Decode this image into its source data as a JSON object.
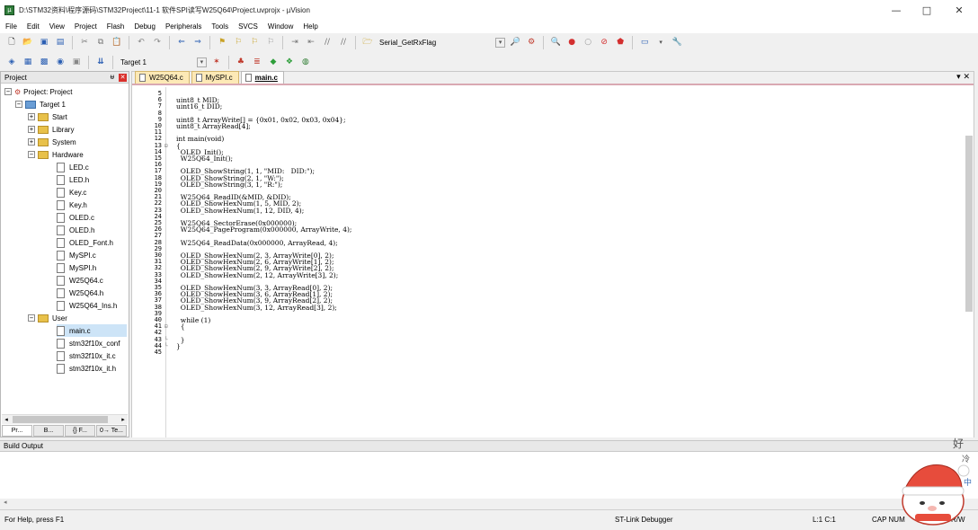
{
  "window": {
    "title": "D:\\STM32资料\\程序源码\\STM32Project\\11-1 软件SPI读写W25Q64\\Project.uvprojx - µVision",
    "minimize": "—",
    "maximize": "□",
    "close": "✕"
  },
  "menu": [
    "File",
    "Edit",
    "View",
    "Project",
    "Flash",
    "Debug",
    "Peripherals",
    "Tools",
    "SVCS",
    "Window",
    "Help"
  ],
  "toolbar": {
    "find_combo": "Serial_GetRxFlag",
    "target_combo": "Target 1"
  },
  "project_panel": {
    "title": "Project",
    "pin": "ᵾ",
    "close": "✕",
    "tree": {
      "root": "Project: Project",
      "target": "Target 1",
      "groups": [
        "Start",
        "Library",
        "System"
      ],
      "hardware": {
        "label": "Hardware",
        "files": [
          "LED.c",
          "LED.h",
          "Key.c",
          "Key.h",
          "OLED.c",
          "OLED.h",
          "OLED_Font.h",
          "MySPI.c",
          "MySPI.h",
          "W25Q64.c",
          "W25Q64.h",
          "W25Q64_Ins.h"
        ]
      },
      "user": {
        "label": "User",
        "files": [
          "main.c",
          "stm32f10x_conf",
          "stm32f10x_it.c",
          "stm32f10x_it.h"
        ]
      }
    },
    "tabs": [
      "Pr...",
      "B...",
      "{} F...",
      "0→ Te..."
    ]
  },
  "editor": {
    "tabs": [
      "W25Q64.c",
      "MySPI.c",
      "main.c"
    ],
    "active_tab": "main.c",
    "close": "▾ ✕",
    "lines": [
      {
        "n": "5",
        "t": ""
      },
      {
        "n": "6",
        "t": "uint8_t MID;"
      },
      {
        "n": "7",
        "t": "uint16_t DID;"
      },
      {
        "n": "8",
        "t": ""
      },
      {
        "n": "9",
        "t": "uint8_t ArrayWrite[] = {0x01, 0x02, 0x03, 0x04};"
      },
      {
        "n": "10",
        "t": "uint8_t ArrayRead[4];"
      },
      {
        "n": "11",
        "t": ""
      },
      {
        "n": "12",
        "t": "int main(void)"
      },
      {
        "n": "13",
        "t": "{"
      },
      {
        "n": "14",
        "t": "  OLED_Init();"
      },
      {
        "n": "15",
        "t": "  W25Q64_Init();"
      },
      {
        "n": "16",
        "t": ""
      },
      {
        "n": "17",
        "t": "  OLED_ShowString(1, 1, \"MID:   DID:\");"
      },
      {
        "n": "18",
        "t": "  OLED_ShowString(2, 1, \"W:\");"
      },
      {
        "n": "19",
        "t": "  OLED_ShowString(3, 1, \"R:\");"
      },
      {
        "n": "20",
        "t": ""
      },
      {
        "n": "21",
        "t": "  W25Q64_ReadID(&MID, &DID);"
      },
      {
        "n": "22",
        "t": "  OLED_ShowHexNum(1, 5, MID, 2);"
      },
      {
        "n": "23",
        "t": "  OLED_ShowHexNum(1, 12, DID, 4);"
      },
      {
        "n": "24",
        "t": ""
      },
      {
        "n": "25",
        "t": "  W25Q64_SectorErase(0x000000);"
      },
      {
        "n": "26",
        "t": "  W25Q64_PageProgram(0x000000, ArrayWrite, 4);"
      },
      {
        "n": "27",
        "t": ""
      },
      {
        "n": "28",
        "t": "  W25Q64_ReadData(0x000000, ArrayRead, 4);"
      },
      {
        "n": "29",
        "t": ""
      },
      {
        "n": "30",
        "t": "  OLED_ShowHexNum(2, 3, ArrayWrite[0], 2);"
      },
      {
        "n": "31",
        "t": "  OLED_ShowHexNum(2, 6, ArrayWrite[1], 2);"
      },
      {
        "n": "32",
        "t": "  OLED_ShowHexNum(2, 9, ArrayWrite[2], 2);"
      },
      {
        "n": "33",
        "t": "  OLED_ShowHexNum(2, 12, ArrayWrite[3], 2);"
      },
      {
        "n": "34",
        "t": ""
      },
      {
        "n": "35",
        "t": "  OLED_ShowHexNum(3, 3, ArrayRead[0], 2);"
      },
      {
        "n": "36",
        "t": "  OLED_ShowHexNum(3, 6, ArrayRead[1], 2);"
      },
      {
        "n": "37",
        "t": "  OLED_ShowHexNum(3, 9, ArrayRead[2], 2);"
      },
      {
        "n": "38",
        "t": "  OLED_ShowHexNum(3, 12, ArrayRead[3], 2);"
      },
      {
        "n": "39",
        "t": ""
      },
      {
        "n": "40",
        "t": "  while (1)"
      },
      {
        "n": "41",
        "t": "  {"
      },
      {
        "n": "42",
        "t": ""
      },
      {
        "n": "43",
        "t": "  }"
      },
      {
        "n": "44",
        "t": "}"
      },
      {
        "n": "45",
        "t": ""
      }
    ]
  },
  "build_output": {
    "title": "Build Output"
  },
  "status": {
    "help": "For Help, press F1",
    "debugger": "ST-Link Debugger",
    "position": "L:1 C:1",
    "caps": "CAP NUM",
    "rw": "R/W"
  },
  "colors": {
    "tab_active_underline": "#d9a8b2",
    "tab_inactive": "#fde9b6",
    "tree_selected": "#cde4f7"
  }
}
